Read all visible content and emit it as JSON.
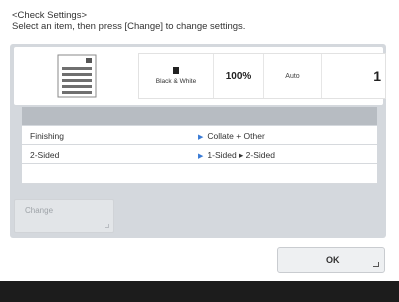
{
  "header": {
    "title": "<Check Settings>",
    "instruction": "Select an item, then press [Change] to change settings."
  },
  "status": {
    "color_mode": "Black & White",
    "copy_ratio": "100%",
    "paper": "Auto",
    "copies": "1"
  },
  "settings_list": [
    {
      "name": "Finishing",
      "value": "Collate + Other"
    },
    {
      "name": "2-Sided",
      "value": "1-Sided ▸ 2-Sided"
    }
  ],
  "buttons": {
    "change_label": "Change",
    "ok_label": "OK"
  },
  "icons": {
    "machine": "copier-machine-icon",
    "color_swatch": "black-white-swatch-icon"
  }
}
